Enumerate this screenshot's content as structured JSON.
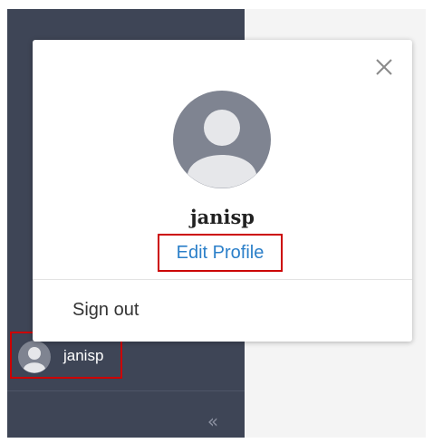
{
  "user": {
    "username": "janisp"
  },
  "popover": {
    "name": "janisp",
    "edit_profile_label": "Edit Profile",
    "sign_out_label": "Sign out",
    "close_icon": "close-icon"
  },
  "sidebar": {
    "username": "janisp",
    "collapse_glyph": "«",
    "collapse_icon": "double-chevron-left-icon"
  },
  "colors": {
    "sidebar_bg": "#3e4556",
    "link": "#2b7fc9",
    "highlight": "#cc0000",
    "avatar_bg": "#7f8491"
  }
}
